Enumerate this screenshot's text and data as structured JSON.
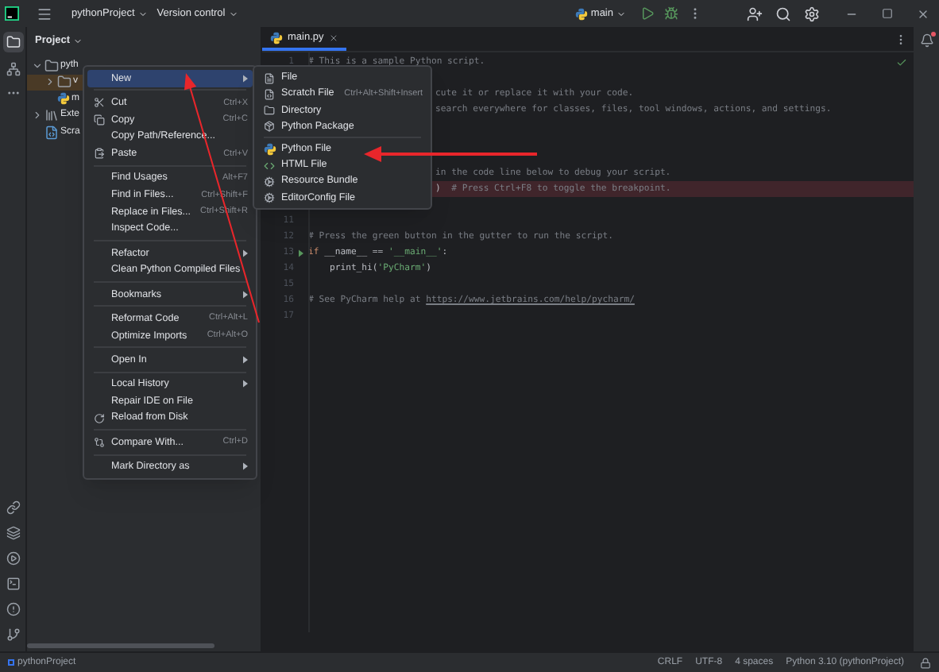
{
  "title_bar": {
    "project": "pythonProject",
    "vcs": "Version control",
    "branch": "main"
  },
  "project_panel": {
    "title": "Project",
    "tree": [
      {
        "label": "pyth",
        "kind": "folder",
        "expanded": true,
        "selected": false,
        "children": [
          {
            "label": "v",
            "kind": "folder",
            "expanded": false,
            "selected": true
          },
          {
            "label": "m",
            "kind": "python",
            "selected": false
          }
        ]
      },
      {
        "label": "Exte",
        "kind": "library",
        "expanded": false,
        "selected": false
      },
      {
        "label": "Scra",
        "kind": "scratch",
        "selected": false
      }
    ]
  },
  "editor": {
    "tab": {
      "label": "main.py",
      "selected": true
    },
    "lines": [
      {
        "kind": "code",
        "number": "1",
        "tokens": [
          {
            "kind": "comment",
            "text": "# This is a sample Python script."
          }
        ]
      },
      {
        "kind": "blank"
      },
      {
        "kind": "clipped",
        "tokens": [
          {
            "kind": "comment",
            "text": "cute it or replace it with your code."
          }
        ]
      },
      {
        "kind": "clipped",
        "tokens": [
          {
            "kind": "comment",
            "text": "search everywhere for classes, files, tool windows, actions, and settings."
          }
        ]
      },
      {
        "kind": "blank"
      },
      {
        "kind": "blank"
      },
      {
        "kind": "blank"
      },
      {
        "kind": "clipped",
        "tokens": [
          {
            "kind": "comment",
            "text": "in the code line below to debug your script."
          }
        ]
      },
      {
        "kind": "clipped",
        "breakpoint": true,
        "tokens": [
          {
            "kind": "plain",
            "text": ")"
          },
          {
            "kind": "comment",
            "text": "  # Press Ctrl+F8 to toggle the breakpoint."
          }
        ]
      },
      {
        "kind": "blank"
      },
      {
        "kind": "code",
        "number": "11"
      },
      {
        "kind": "code",
        "number": "12",
        "tokens": [
          {
            "kind": "comment",
            "text": "# Press the green button in the gutter to run the script."
          }
        ]
      },
      {
        "kind": "code",
        "number": "13",
        "run_marker": true,
        "tokens": [
          {
            "kind": "keyword",
            "text": "if"
          },
          {
            "kind": "plain",
            "text": " __name__ == "
          },
          {
            "kind": "string",
            "text": "'__main__'"
          },
          {
            "kind": "plain",
            "text": ":"
          }
        ]
      },
      {
        "kind": "code",
        "number": "14",
        "tokens": [
          {
            "kind": "plain",
            "text": "    print_hi("
          },
          {
            "kind": "string",
            "text": "'PyCharm'"
          },
          {
            "kind": "plain",
            "text": ")"
          }
        ]
      },
      {
        "kind": "code",
        "number": "15"
      },
      {
        "kind": "code",
        "number": "16",
        "tokens": [
          {
            "kind": "comment",
            "text": "# See PyCharm help at "
          },
          {
            "kind": "link",
            "text": "https://www.jetbrains.com/help/pycharm/"
          }
        ]
      },
      {
        "kind": "code",
        "number": "17"
      }
    ]
  },
  "context_menu": {
    "items": [
      {
        "kind": "item",
        "label": "New",
        "submenu": true,
        "selected": true
      },
      {
        "kind": "separator"
      },
      {
        "kind": "item",
        "label": "Cut",
        "shortcut": "Ctrl+X",
        "selected": false
      },
      {
        "kind": "item",
        "label": "Copy",
        "shortcut": "Ctrl+C",
        "selected": false
      },
      {
        "kind": "item",
        "label": "Copy Path/Reference...",
        "selected": false
      },
      {
        "kind": "item",
        "label": "Paste",
        "shortcut": "Ctrl+V",
        "selected": false
      },
      {
        "kind": "separator"
      },
      {
        "kind": "item",
        "label": "Find Usages",
        "shortcut": "Alt+F7",
        "selected": false
      },
      {
        "kind": "item",
        "label": "Find in Files...",
        "shortcut": "Ctrl+Shift+F",
        "selected": false
      },
      {
        "kind": "item",
        "label": "Replace in Files...",
        "shortcut": "Ctrl+Shift+R",
        "selected": false
      },
      {
        "kind": "item",
        "label": "Inspect Code...",
        "selected": false
      },
      {
        "kind": "separator"
      },
      {
        "kind": "item",
        "label": "Refactor",
        "submenu": true,
        "selected": false
      },
      {
        "kind": "item",
        "label": "Clean Python Compiled Files",
        "selected": false
      },
      {
        "kind": "separator"
      },
      {
        "kind": "item",
        "label": "Bookmarks",
        "submenu": true,
        "selected": false
      },
      {
        "kind": "separator"
      },
      {
        "kind": "item",
        "label": "Reformat Code",
        "shortcut": "Ctrl+Alt+L",
        "selected": false
      },
      {
        "kind": "item",
        "label": "Optimize Imports",
        "shortcut": "Ctrl+Alt+O",
        "selected": false
      },
      {
        "kind": "separator"
      },
      {
        "kind": "item",
        "label": "Open In",
        "submenu": true,
        "selected": false
      },
      {
        "kind": "separator"
      },
      {
        "kind": "item",
        "label": "Local History",
        "submenu": true,
        "selected": false
      },
      {
        "kind": "item",
        "label": "Repair IDE on File",
        "selected": false
      },
      {
        "kind": "item",
        "label": "Reload from Disk",
        "selected": false
      },
      {
        "kind": "separator"
      },
      {
        "kind": "item",
        "label": "Compare With...",
        "shortcut": "Ctrl+D",
        "selected": false
      },
      {
        "kind": "separator"
      },
      {
        "kind": "item",
        "label": "Mark Directory as",
        "submenu": true,
        "selected": false
      }
    ]
  },
  "new_submenu": {
    "items": [
      {
        "kind": "item",
        "label": "File"
      },
      {
        "kind": "item",
        "label": "Scratch File",
        "shortcut": "Ctrl+Alt+Shift+Insert"
      },
      {
        "kind": "item",
        "label": "Directory"
      },
      {
        "kind": "item",
        "label": "Python Package"
      },
      {
        "kind": "separator"
      },
      {
        "kind": "item",
        "label": "Python File"
      },
      {
        "kind": "item",
        "label": "HTML File"
      },
      {
        "kind": "item",
        "label": "Resource Bundle"
      },
      {
        "kind": "item",
        "label": "EditorConfig File"
      }
    ]
  },
  "status_bar": {
    "project": "pythonProject",
    "items": [
      "CRLF",
      "UTF-8",
      "4 spaces",
      "Python 3.10 (pythonProject)"
    ]
  }
}
